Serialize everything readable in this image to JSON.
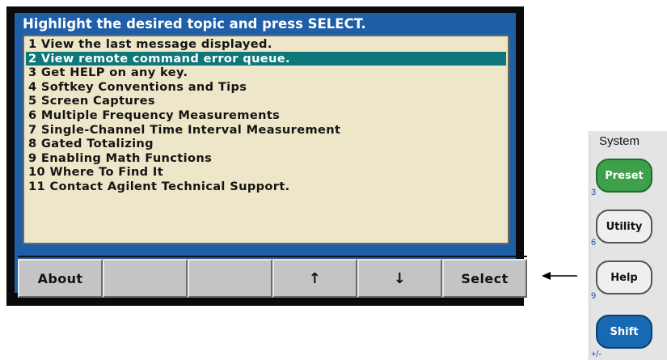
{
  "screen": {
    "header": "Highlight the desired topic and press SELECT.",
    "topics": [
      {
        "label": "1 View the last message displayed.",
        "selected": false
      },
      {
        "label": "2 View remote command error queue.",
        "selected": true
      },
      {
        "label": "3 Get HELP on any key.",
        "selected": false
      },
      {
        "label": "4 Softkey Conventions and Tips",
        "selected": false
      },
      {
        "label": "5 Screen Captures",
        "selected": false
      },
      {
        "label": "6 Multiple Frequency Measurements",
        "selected": false
      },
      {
        "label": "7 Single-Channel Time Interval Measurement",
        "selected": false
      },
      {
        "label": "8 Gated Totalizing",
        "selected": false
      },
      {
        "label": "9 Enabling Math Functions",
        "selected": false
      },
      {
        "label": "10 Where To Find It",
        "selected": false
      },
      {
        "label": "11 Contact Agilent Technical Support.",
        "selected": false
      }
    ],
    "softkeys": {
      "about": "About",
      "blank1": "",
      "blank2": "",
      "up": "↑",
      "down": "↓",
      "select": "Select"
    }
  },
  "panel": {
    "title": "System",
    "preset": "Preset",
    "utility": "Utility",
    "help": "Help",
    "shift": "Shift",
    "digits": [
      "3",
      "6",
      "9",
      "+/-"
    ]
  },
  "colors": {
    "screen_bg": "#1f5fa8",
    "list_bg": "#ede6c8",
    "highlight": "#0e7779",
    "softkey": "#c4c4c4",
    "preset_key": "#3ea04a",
    "shift_key": "#1869b3"
  },
  "icons": {
    "pointer": "left-arrow-icon",
    "up": "up-arrow-icon",
    "down": "down-arrow-icon"
  }
}
